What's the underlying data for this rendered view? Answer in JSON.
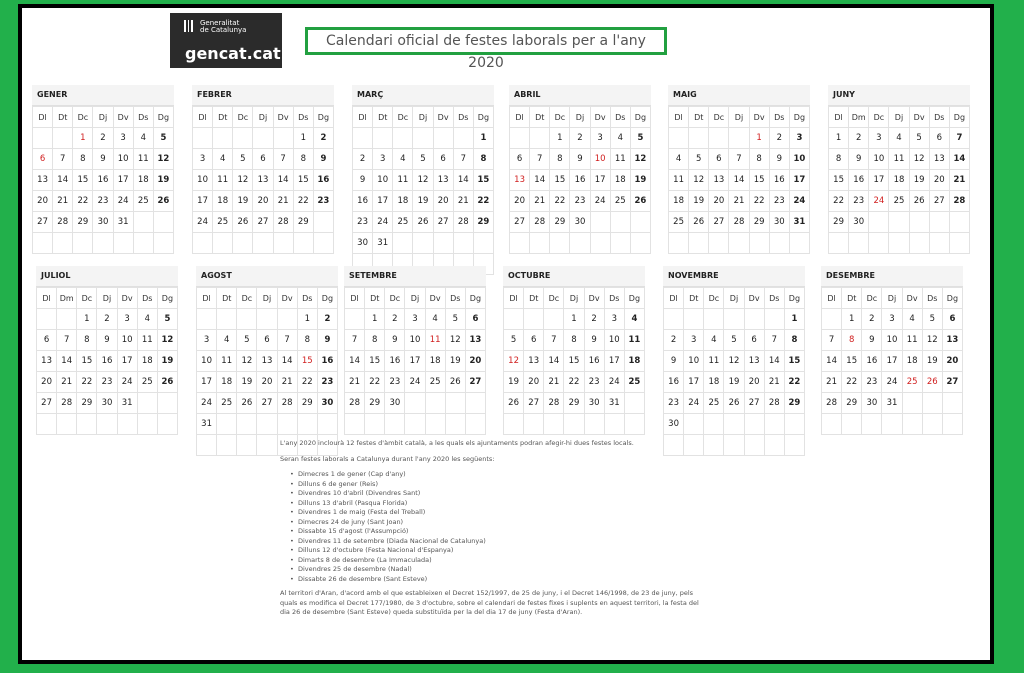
{
  "logo": {
    "org_line1": "Generalitat",
    "org_line2": "de Catalunya",
    "name": "gencat.cat"
  },
  "title": "Calendari oficial de festes laborals per a l'any 2020",
  "weekdays_default": [
    "Dl",
    "Dt",
    "Dc",
    "Dj",
    "Dv",
    "Ds",
    "Dg"
  ],
  "weekdays_juliol": [
    "Dl",
    "Dm",
    "Dc",
    "Dj",
    "Dv",
    "Ds",
    "Dg"
  ],
  "weekdays_juny": [
    "Dl",
    "Dm",
    "Dc",
    "Dj",
    "Dv",
    "Ds",
    "Dg"
  ],
  "months": [
    {
      "name": "GENER",
      "offset": 2,
      "days": 31,
      "holidays": [
        1,
        6
      ],
      "rows": 6
    },
    {
      "name": "FEBRER",
      "offset": 5,
      "days": 29,
      "holidays": [],
      "rows": 6
    },
    {
      "name": "MARÇ",
      "offset": 6,
      "days": 31,
      "holidays": [],
      "rows": 7
    },
    {
      "name": "ABRIL",
      "offset": 2,
      "days": 30,
      "holidays": [
        10,
        13
      ],
      "rows": 6
    },
    {
      "name": "MAIG",
      "offset": 4,
      "days": 31,
      "holidays": [
        1
      ],
      "rows": 6
    },
    {
      "name": "JUNY",
      "offset": 0,
      "days": 30,
      "holidays": [
        24
      ],
      "rows": 6
    },
    {
      "name": "JULIOL",
      "offset": 2,
      "days": 31,
      "holidays": [],
      "rows": 6
    },
    {
      "name": "AGOST",
      "offset": 5,
      "days": 31,
      "holidays": [
        15
      ],
      "rows": 7
    },
    {
      "name": "SETEMBRE",
      "offset": 1,
      "days": 30,
      "holidays": [
        11
      ],
      "rows": 6
    },
    {
      "name": "OCTUBRE",
      "offset": 3,
      "days": 31,
      "holidays": [
        12
      ],
      "rows": 6
    },
    {
      "name": "NOVEMBRE",
      "offset": 6,
      "days": 30,
      "holidays": [],
      "rows": 7
    },
    {
      "name": "DESEMBRE",
      "offset": 1,
      "days": 31,
      "holidays": [
        8,
        25,
        26
      ],
      "rows": 6
    }
  ],
  "text": {
    "intro": "L'any 2020 inclourà 12 festes d'àmbit català, a les quals els ajuntaments podran afegir-hi dues festes locals.",
    "lead": "Seran festes laborals a Catalunya durant l'any 2020 les següents:",
    "holidays": [
      "Dimecres 1 de gener (Cap d'any)",
      "Dilluns 6 de gener (Reis)",
      "Divendres 10 d'abril (Divendres Sant)",
      "Dilluns 13 d'abril (Pasqua Florida)",
      "Divendres 1 de maig (Festa del Treball)",
      "Dimecres 24 de juny (Sant Joan)",
      "Dissabte 15 d'agost (l'Assumpció)",
      "Divendres 11 de setembre (Diada Nacional de Catalunya)",
      "Dilluns 12 d'octubre (Festa Nacional d'Espanya)",
      "Dimarts 8 de desembre (La Immaculada)",
      "Divendres 25 de desembre (Nadal)",
      "Dissabte 26 de desembre (Sant Esteve)"
    ],
    "aran": "Al territori d'Aran, d'acord amb el que estableixen el Decret 152/1997, de 25 de juny, i el Decret 146/1998, de 23 de juny, pels quals es modifica el Decret 177/1980, de 3 d'octubre, sobre el calendari de festes fixes i suplents en aquest territori, la festa del dia 26 de desembre (Sant Esteve) queda substituïda per la del dia 17 de juny (Festa d'Aran)."
  }
}
